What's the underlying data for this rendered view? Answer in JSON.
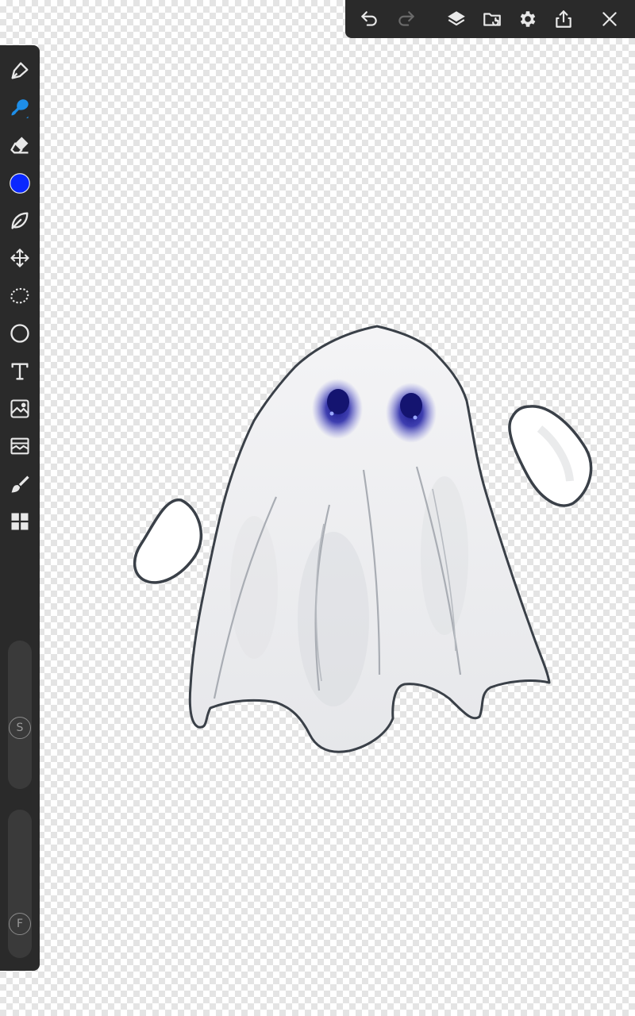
{
  "colors": {
    "toolbar_bg": "#2a2a2a",
    "icon": "#e8e8e8",
    "icon_disabled": "#6a6a6a",
    "active_tool": "#1e8ee8",
    "current_color": "#0a28ff",
    "ghost_outline": "#3a4048",
    "ghost_eye": "#1a1a8c"
  },
  "top_toolbar": {
    "buttons": [
      {
        "name": "undo",
        "icon": "undo-icon",
        "enabled": true
      },
      {
        "name": "redo",
        "icon": "redo-icon",
        "enabled": false
      },
      {
        "name": "layers",
        "icon": "layers-icon"
      },
      {
        "name": "gallery-save",
        "icon": "folder-save-icon"
      },
      {
        "name": "settings",
        "icon": "gear-icon"
      },
      {
        "name": "share",
        "icon": "share-icon"
      },
      {
        "name": "close",
        "icon": "close-icon"
      }
    ]
  },
  "left_toolbar": {
    "tools": [
      {
        "name": "pen",
        "icon": "pen-icon"
      },
      {
        "name": "brush",
        "icon": "brush-icon",
        "active": true
      },
      {
        "name": "eraser",
        "icon": "eraser-icon"
      },
      {
        "name": "color",
        "icon": "color-swatch-icon"
      },
      {
        "name": "lasso-fill",
        "icon": "leaf-icon"
      },
      {
        "name": "transform",
        "icon": "move-arrows-icon"
      },
      {
        "name": "selection",
        "icon": "lasso-select-icon"
      },
      {
        "name": "shape",
        "icon": "circle-icon"
      },
      {
        "name": "text",
        "icon": "text-icon"
      },
      {
        "name": "image-import",
        "icon": "image-import-icon"
      },
      {
        "name": "filter",
        "icon": "filter-icon"
      },
      {
        "name": "smudge",
        "icon": "paint-brush-icon"
      },
      {
        "name": "materials",
        "icon": "grid-icon"
      }
    ],
    "size_slider_label": "S",
    "opacity_slider_label": "F"
  }
}
